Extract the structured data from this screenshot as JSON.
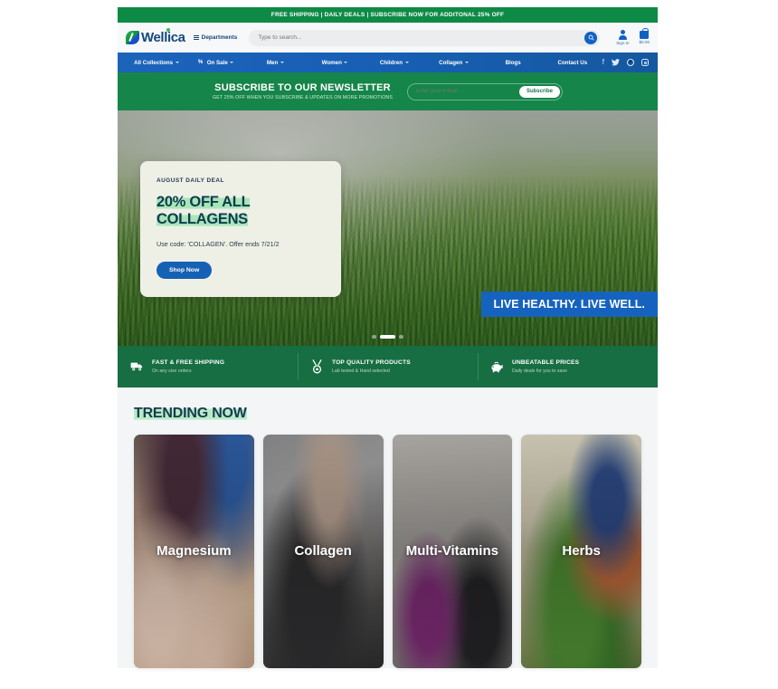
{
  "announcement": {
    "text": "FREE SHIPPING | DAILY DEALS | SUBSCRIBE NOW FOR ADDITONAL 25% OFF"
  },
  "header": {
    "logo_text": "Wellica",
    "logo_icon": "leaf-icon",
    "departments_label": "Departments",
    "departments_icon": "list-icon",
    "search": {
      "placeholder": "Type to search...",
      "value": "",
      "icon": "search-icon"
    },
    "account": {
      "label": "Sign In",
      "icon": "user-icon"
    },
    "cart": {
      "label": "$0.00",
      "icon": "bag-icon"
    }
  },
  "nav": {
    "items": [
      {
        "label": "All Collections",
        "has_dropdown": true,
        "icon": ""
      },
      {
        "label": "On Sale",
        "has_dropdown": true,
        "icon": "percent-icon"
      },
      {
        "label": "Men",
        "has_dropdown": true,
        "icon": ""
      },
      {
        "label": "Women",
        "has_dropdown": true,
        "icon": ""
      },
      {
        "label": "Children",
        "has_dropdown": true,
        "icon": ""
      },
      {
        "label": "Collagen",
        "has_dropdown": true,
        "icon": ""
      },
      {
        "label": "Blogs",
        "has_dropdown": false,
        "icon": ""
      },
      {
        "label": "Contact Us",
        "has_dropdown": false,
        "icon": ""
      }
    ],
    "socials": [
      {
        "name": "facebook-icon",
        "glyph": "f"
      },
      {
        "name": "twitter-icon",
        "glyph": "✉"
      },
      {
        "name": "pinterest-icon",
        "glyph": "P"
      },
      {
        "name": "instagram-icon",
        "glyph": ""
      }
    ]
  },
  "newsletter": {
    "title": "SUBSCRIBE TO OUR NEWSLETTER",
    "subtitle": "GET 25% OFF WHEN YOU SUBSCRIBE & UPDATES ON MORE PROMOTIONS",
    "input_placeholder": "Enter your e-mail",
    "input_value": "",
    "button_label": "Subscribe"
  },
  "hero": {
    "card": {
      "eyebrow": "AUGUST DAILY DEAL",
      "title_line1": "20% OFF ALL",
      "title_line2": "COLLAGENS",
      "description": "Use code: 'COLLAGEN'. Offer ends 7/21/2",
      "button_label": "Shop Now"
    },
    "banner_text": "LIVE HEALTHY. LIVE WELL.",
    "slides": 3,
    "active_slide": 1
  },
  "features": [
    {
      "title": "FAST & FREE SHIPPING",
      "subtitle": "On any size orders",
      "icon": "truck-icon"
    },
    {
      "title": "TOP QUALITY PRODUCTS",
      "subtitle": "Lab tested & Hand selected",
      "icon": "medal-icon"
    },
    {
      "title": "UNBEATABLE PRICES",
      "subtitle": "Daily deals for you to save",
      "icon": "piggy-bank-icon"
    }
  ],
  "trending": {
    "heading": "TRENDING NOW",
    "cards": [
      {
        "label": "Magnesium",
        "image": "img-magnesium"
      },
      {
        "label": "Collagen",
        "image": "img-collagen"
      },
      {
        "label": "Multi-Vitamins",
        "image": "img-multi"
      },
      {
        "label": "Herbs",
        "image": "img-herbs"
      }
    ]
  },
  "colors": {
    "announce_green": "#0e8a47",
    "newsletter_green": "#16854a",
    "features_green": "#166e42",
    "nav_blue": "#1760b6",
    "accent_blue": "#1561b4",
    "navy_text": "#14477d",
    "highlight_green": "#a8e6b9",
    "page_bg": "#f3f5f7"
  }
}
